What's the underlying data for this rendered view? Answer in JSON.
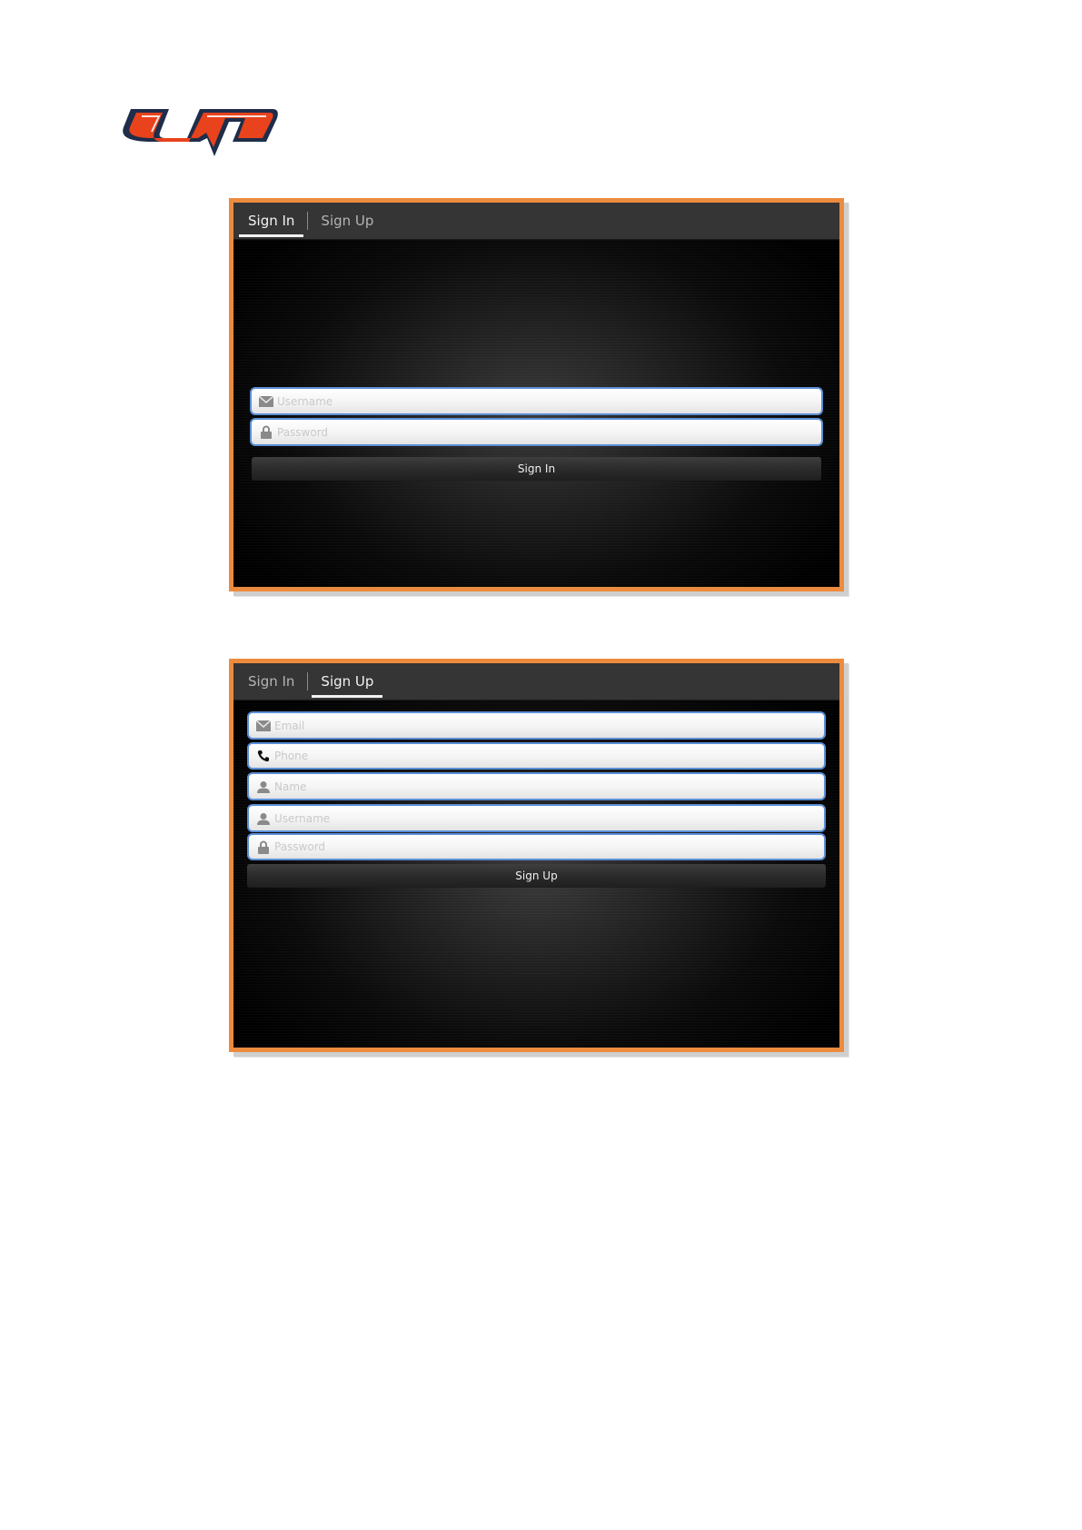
{
  "brand": {
    "logo_icon": "um-logo",
    "colors": {
      "primary": "#e8431c",
      "outline": "#1e2d4a",
      "frame": "#ec8b3e",
      "field_border": "#5b8fd6"
    }
  },
  "signin_screen": {
    "tabs": [
      {
        "label": "Sign In",
        "active": true
      },
      {
        "label": "Sign Up",
        "active": false
      }
    ],
    "fields": [
      {
        "icon": "envelope-icon",
        "placeholder": "Username",
        "value": ""
      },
      {
        "icon": "lock-icon",
        "placeholder": "Password",
        "value": ""
      }
    ],
    "submit_label": "Sign In"
  },
  "signup_screen": {
    "tabs": [
      {
        "label": "Sign In",
        "active": false
      },
      {
        "label": "Sign Up",
        "active": true
      }
    ],
    "fields": [
      {
        "icon": "envelope-icon",
        "placeholder": "Email",
        "value": ""
      },
      {
        "icon": "phone-icon",
        "placeholder": "Phone",
        "value": ""
      },
      {
        "icon": "person-icon",
        "placeholder": "Name",
        "value": ""
      },
      {
        "icon": "person-icon",
        "placeholder": "Username",
        "value": ""
      },
      {
        "icon": "lock-icon",
        "placeholder": "Password",
        "value": ""
      }
    ],
    "submit_label": "Sign Up"
  }
}
